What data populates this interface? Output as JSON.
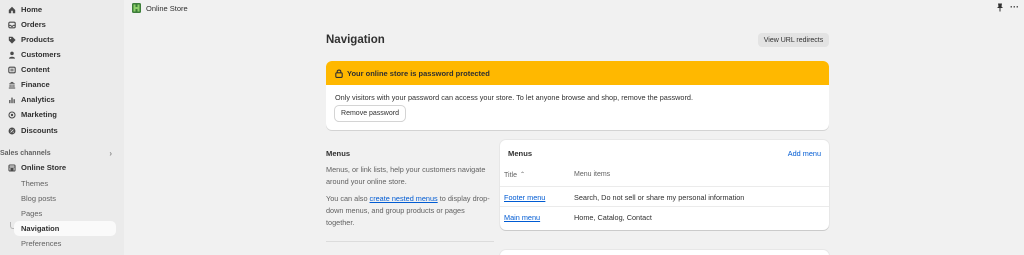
{
  "sidebar": {
    "items": [
      {
        "label": "Home",
        "icon": "home-icon"
      },
      {
        "label": "Orders",
        "icon": "inbox-icon"
      },
      {
        "label": "Products",
        "icon": "tag-icon"
      },
      {
        "label": "Customers",
        "icon": "person-icon"
      },
      {
        "label": "Content",
        "icon": "content-icon"
      },
      {
        "label": "Finance",
        "icon": "bank-icon"
      },
      {
        "label": "Analytics",
        "icon": "bar-chart-icon"
      },
      {
        "label": "Marketing",
        "icon": "target-icon"
      },
      {
        "label": "Discounts",
        "icon": "discount-icon"
      }
    ],
    "sales_channels_label": "Sales channels",
    "online_store_label": "Online Store",
    "sub_items": [
      "Themes",
      "Blog posts",
      "Pages",
      "Navigation",
      "Preferences"
    ],
    "active_sub_item": "Navigation"
  },
  "topbar": {
    "title": "Online Store"
  },
  "page": {
    "title": "Navigation",
    "redirects_button": "View URL redirects"
  },
  "alert": {
    "title": "Your online store is password protected",
    "body": "Only visitors with your password can access your store. To let anyone browse and shop, remove the password.",
    "button": "Remove password",
    "color": "#ffb800"
  },
  "menus_section": {
    "heading": "Menus",
    "desc1": "Menus, or link lists, help your customers navigate around your online store.",
    "desc2_prefix": "You can also ",
    "desc2_link": "create nested menus",
    "desc2_suffix": " to display drop-down menus, and group products or pages together."
  },
  "menus_card": {
    "title": "Menus",
    "add_label": "Add menu",
    "columns": [
      "Title",
      "Menu items"
    ],
    "rows": [
      {
        "title": "Footer menu",
        "items": "Search, Do not sell or share my personal information"
      },
      {
        "title": "Main menu",
        "items": "Home, Catalog, Contact"
      }
    ]
  },
  "colors": {
    "accent_link": "#005bd3",
    "warning": "#ffb800",
    "sidebar_bg": "#ebebeb",
    "page_bg": "#f1f1f1"
  }
}
